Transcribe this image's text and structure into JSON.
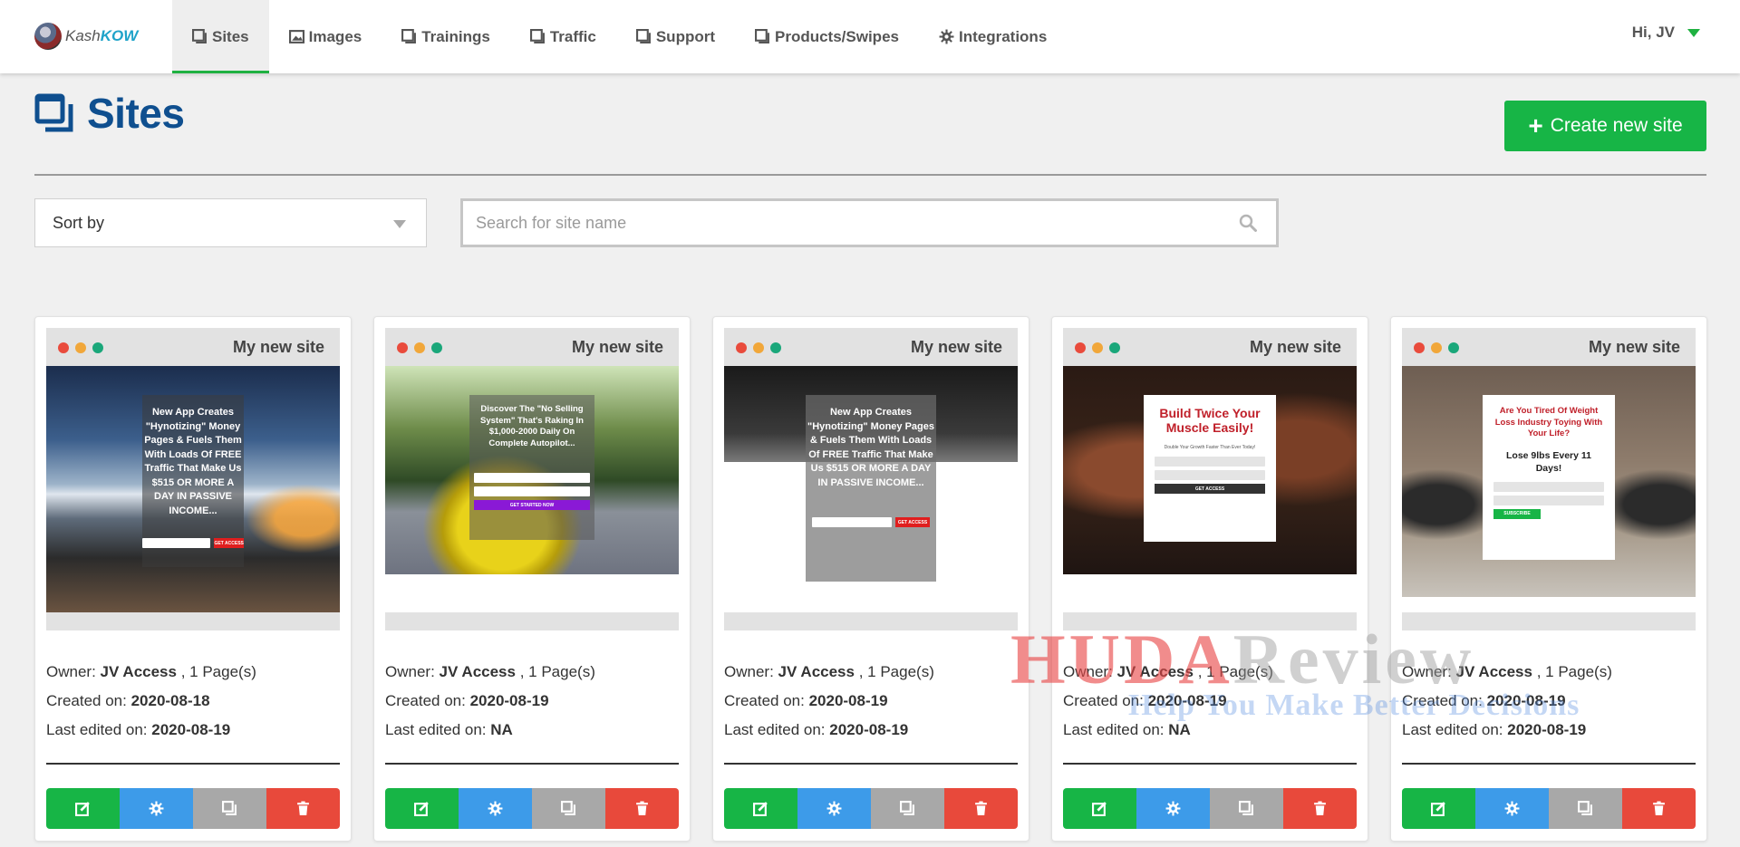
{
  "nav": {
    "logo_prefix": "Kash",
    "logo_suffix": "KOW",
    "items": [
      {
        "label": "Sites",
        "icon": "window-icon",
        "active": true
      },
      {
        "label": "Images",
        "icon": "image-icon",
        "active": false
      },
      {
        "label": "Trainings",
        "icon": "window-icon",
        "active": false
      },
      {
        "label": "Traffic",
        "icon": "window-icon",
        "active": false
      },
      {
        "label": "Support",
        "icon": "window-icon",
        "active": false
      },
      {
        "label": "Products/Swipes",
        "icon": "window-icon",
        "active": false
      },
      {
        "label": "Integrations",
        "icon": "gear-icon",
        "active": false
      }
    ],
    "user_greeting": "Hi, JV"
  },
  "page": {
    "title": "Sites",
    "create_label": "Create new site",
    "sort_label": "Sort by",
    "search_placeholder": "Search for site name"
  },
  "labels": {
    "owner": "Owner:",
    "created": "Created on:",
    "edited": "Last edited on:"
  },
  "sites": [
    {
      "name": "My new site",
      "owner": "JV Access",
      "pages": ", 1 Page(s)",
      "created": "2020-08-18",
      "edited": "2020-08-19",
      "thumb_headline": "New App Creates \"Hynotizing\" Money Pages & Fuels Them With Loads Of FREE Traffic That Make Us $515 OR MORE A DAY IN PASSIVE INCOME...",
      "thumb_button": "GET ACCESS"
    },
    {
      "name": "My new site",
      "owner": "JV Access",
      "pages": ", 1 Page(s)",
      "created": "2020-08-19",
      "edited": "NA",
      "thumb_headline": "Discover The \"No Selling System\" That's Raking In $1,000-2000 Daily On Complete Autopilot...",
      "thumb_button": "GET STARTED NOW"
    },
    {
      "name": "My new site",
      "owner": "JV Access",
      "pages": ", 1 Page(s)",
      "created": "2020-08-19",
      "edited": "2020-08-19",
      "thumb_headline": "New App Creates \"Hynotizing\" Money Pages & Fuels Them With Loads Of FREE Traffic That Make Us $515 OR MORE A DAY IN PASSIVE INCOME...",
      "thumb_button": "GET ACCESS"
    },
    {
      "name": "My new site",
      "owner": "JV Access",
      "pages": ", 1 Page(s)",
      "created": "2020-08-19",
      "edited": "NA",
      "thumb_headline": "Build Twice Your Muscle Easily!",
      "thumb_sub": "Double Your Growth Faster Than Ever Today!",
      "thumb_button": "GET ACCESS"
    },
    {
      "name": "My new site",
      "owner": "JV Access",
      "pages": ", 1 Page(s)",
      "created": "2020-08-19",
      "edited": "2020-08-19",
      "thumb_headline": "Are You Tired Of Weight Loss Industry Toying With Your Life?",
      "thumb_sub": "Lose 9lbs Every 11 Days!",
      "thumb_button": "SUBSCRIBE"
    }
  ],
  "watermark": {
    "brand_a": "HUDA",
    "brand_b": "Review",
    "tagline": "Help You Make Better Decisions"
  },
  "colors": {
    "accent_green": "#17b546",
    "title_blue": "#0f4f8f",
    "settings_blue": "#3d9be9",
    "delete_red": "#e8493b"
  }
}
